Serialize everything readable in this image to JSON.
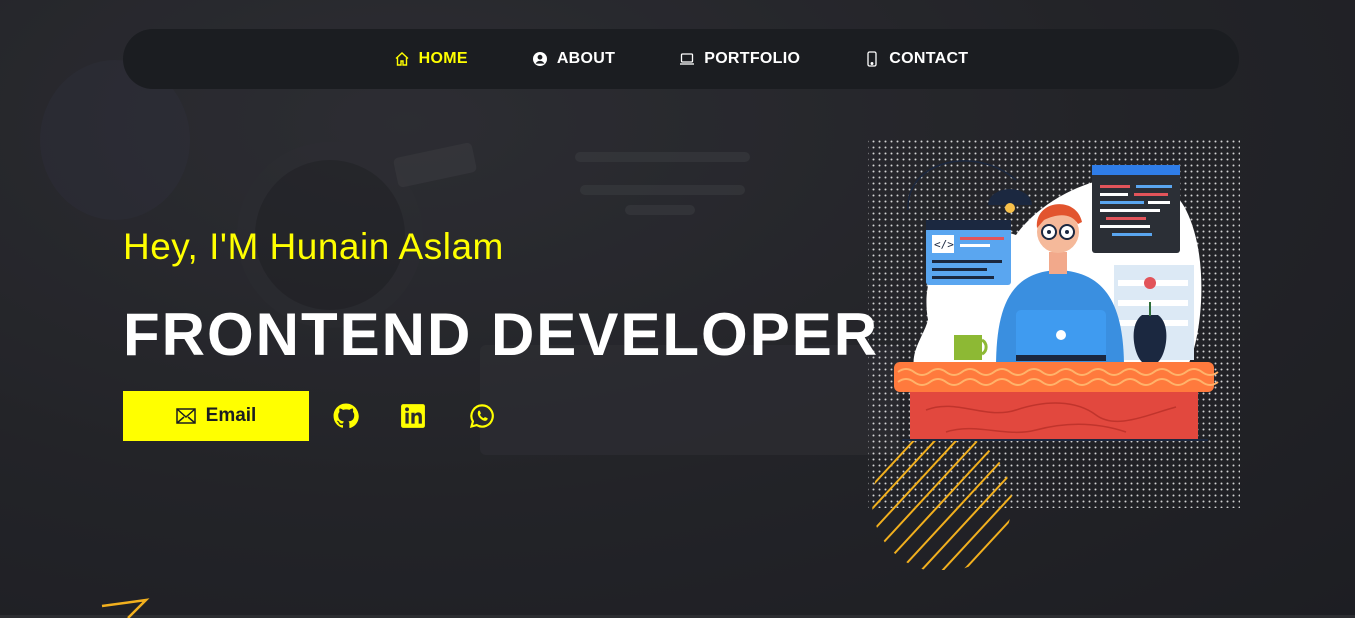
{
  "nav": {
    "items": [
      {
        "label": "HOME",
        "icon": "home-icon",
        "active": true
      },
      {
        "label": "ABOUT",
        "icon": "user-circle-icon",
        "active": false
      },
      {
        "label": "PORTFOLIO",
        "icon": "laptop-icon",
        "active": false
      },
      {
        "label": "CONTACT",
        "icon": "phone-icon",
        "active": false
      }
    ]
  },
  "hero": {
    "greeting": "Hey, I'M Hunain Aslam",
    "title": "FRONTEND DEVELOPER",
    "email_label": "Email"
  },
  "social": [
    {
      "icon": "github-icon"
    },
    {
      "icon": "linkedin-icon"
    },
    {
      "icon": "whatsapp-icon"
    }
  ],
  "colors": {
    "accent": "#ffff00",
    "navbar_bg": "#1b1d21",
    "text": "#ffffff"
  }
}
